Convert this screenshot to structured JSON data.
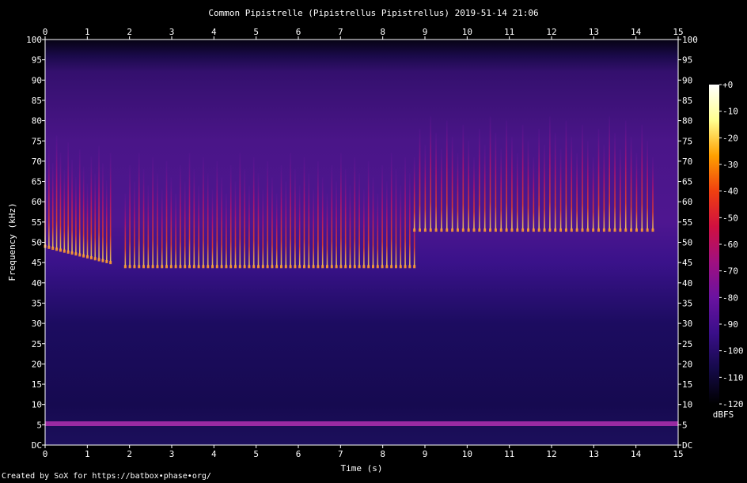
{
  "chart_data": {
    "type": "heatmap",
    "title": "Common Pipistrelle (Pipistrellus Pipistrellus) 2019-51-14 21:06",
    "xlabel": "Time (s)",
    "ylabel": "Frequency (kHz)",
    "xlim": [
      0,
      15
    ],
    "ylim": [
      0,
      100
    ],
    "x_ticks": [
      "0",
      "1",
      "2",
      "3",
      "4",
      "5",
      "6",
      "7",
      "8",
      "9",
      "10",
      "11",
      "12",
      "13",
      "14",
      "15"
    ],
    "y_ticks": [
      "DC",
      "5",
      "10",
      "15",
      "20",
      "25",
      "30",
      "35",
      "40",
      "45",
      "50",
      "55",
      "60",
      "65",
      "70",
      "75",
      "80",
      "85",
      "90",
      "95",
      "100"
    ],
    "colorbar": {
      "label": "dBFS",
      "ticks": [
        "+0",
        "-10",
        "-20",
        "-30",
        "-40",
        "-50",
        "-60",
        "-70",
        "-80",
        "-90",
        "-100",
        "-110",
        "-120"
      ],
      "range": [
        -120,
        0
      ],
      "colors": [
        "#000000",
        "#150a4a",
        "#3a0f8a",
        "#6a12a0",
        "#a01080",
        "#d01040",
        "#f04010",
        "#ffa000",
        "#ffff90",
        "#ffffff"
      ]
    },
    "call_groups": [
      {
        "start_s": 0.0,
        "end_s": 1.55,
        "start_khz": 49,
        "end_khz": 45,
        "calls": 18
      },
      {
        "start_s": 1.9,
        "end_s": 8.75,
        "start_khz": 44,
        "end_khz": 44,
        "calls": 64
      },
      {
        "start_s": 8.75,
        "end_s": 14.4,
        "start_khz": 53,
        "end_khz": 53,
        "calls": 45
      }
    ],
    "background_band_khz": [
      4.5,
      5.5
    ],
    "grid": false
  },
  "footer": {
    "credit": "Created by SoX for https://batbox•phase•org/"
  }
}
